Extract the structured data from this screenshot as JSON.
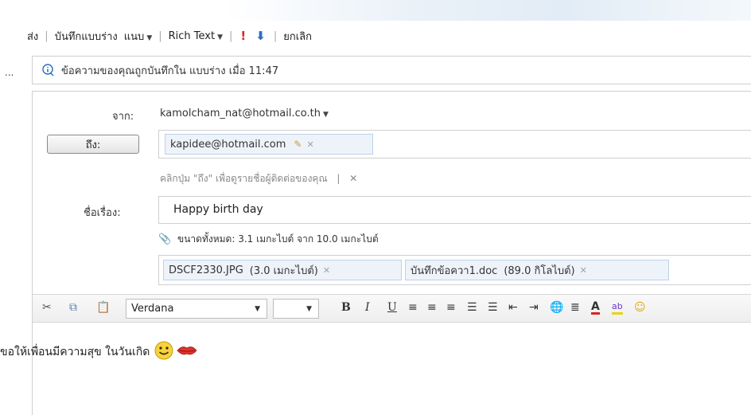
{
  "toolbar": {
    "send_label": "ส่ง",
    "save_draft_label": "บันทึกแบบร่าง",
    "attach_label": "แนบ",
    "rich_text_label": "Rich Text",
    "cancel_label": "ยกเลิก"
  },
  "draft_banner": {
    "message": "ข้อความของคุณถูกบันทึกใน แบบร่าง เมื่อ 11:47"
  },
  "ellipsis": "...",
  "compose": {
    "from_label": "จาก:",
    "from_value": "kamolcham_nat@hotmail.co.th",
    "to_button_label": "ถึง:",
    "to_recipient": "kapidee@hotmail.com",
    "hint_text": "คลิกปุ่ม \"ถึง\" เพื่อดูรายชื่อผู้ติดต่อของคุณ",
    "hint_sep": "|",
    "subject_label": "ชื่อเรื่อง:",
    "subject_value": "Happy birth day",
    "size_info": "ขนาดทั้งหมด: 3.1 เมกะไบต์ จาก 10.0 เมกะไบต์",
    "attachments": [
      {
        "name": "DSCF2330.JPG",
        "size": "(3.0 เมกะไบต์)"
      },
      {
        "name": "บันทึกข้อควา1.doc",
        "size": "(89.0 กิโลไบต์)"
      }
    ]
  },
  "format_bar": {
    "font_value": "Verdana",
    "size_value": "",
    "bold_glyph": "B",
    "italic_glyph": "I",
    "underline_glyph": "U"
  },
  "body": {
    "text": "ขอให้เพื่อนมีความสุข ในวันเกิด"
  },
  "colors": {
    "accent_blue": "#2a6ebd",
    "priority_red": "#d9251d",
    "chip_bg": "#eef3fa",
    "border": "#cfcfcf"
  }
}
